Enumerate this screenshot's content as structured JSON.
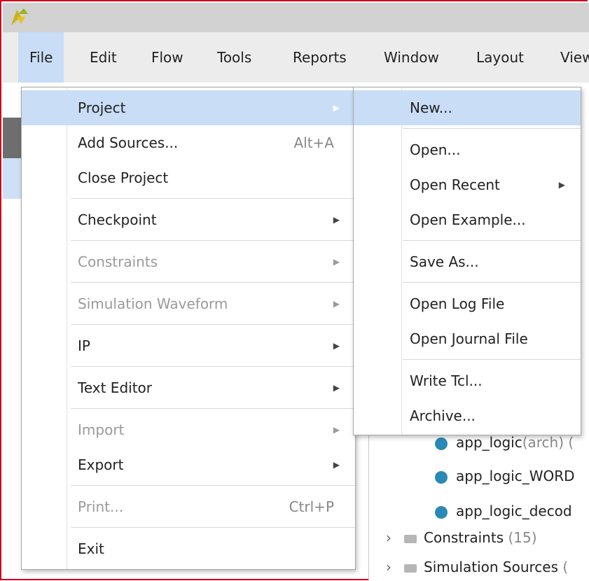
{
  "colors": {
    "accent_highlight": "#c9ddf6",
    "frame_border": "#d0021b",
    "dot": "#2a89b6"
  },
  "menubar": {
    "file": "File",
    "edit": "Edit",
    "flow": "Flow",
    "tools": "Tools",
    "reports": "Reports",
    "window": "Window",
    "layout": "Layout",
    "view": "View"
  },
  "file_menu": {
    "project": "Project",
    "add_sources": "Add Sources...",
    "add_sources_accel": "Alt+A",
    "close_project": "Close Project",
    "checkpoint": "Checkpoint",
    "constraints": "Constraints",
    "simulation_waveform": "Simulation Waveform",
    "ip": "IP",
    "text_editor": "Text Editor",
    "import": "Import",
    "export": "Export",
    "print": "Print...",
    "print_accel": "Ctrl+P",
    "exit": "Exit"
  },
  "project_submenu": {
    "new": "New...",
    "open": "Open...",
    "open_recent": "Open Recent",
    "open_example": "Open Example...",
    "save_as": "Save As...",
    "open_log_file": "Open Log File",
    "open_journal_file": "Open Journal File",
    "write_tcl": "Write Tcl...",
    "archive": "Archive..."
  },
  "background": {
    "rows": [
      {
        "name": "app_logic",
        "suffix": "(arch) ("
      },
      {
        "name": "app_logic_WORD",
        "suffix": ""
      },
      {
        "name": "app_logic_decod",
        "suffix": ""
      }
    ],
    "constraints": "Constraints",
    "constraints_count": "(15)",
    "simulation_sources": "Simulation Sources",
    "simulation_sources_count": "("
  }
}
